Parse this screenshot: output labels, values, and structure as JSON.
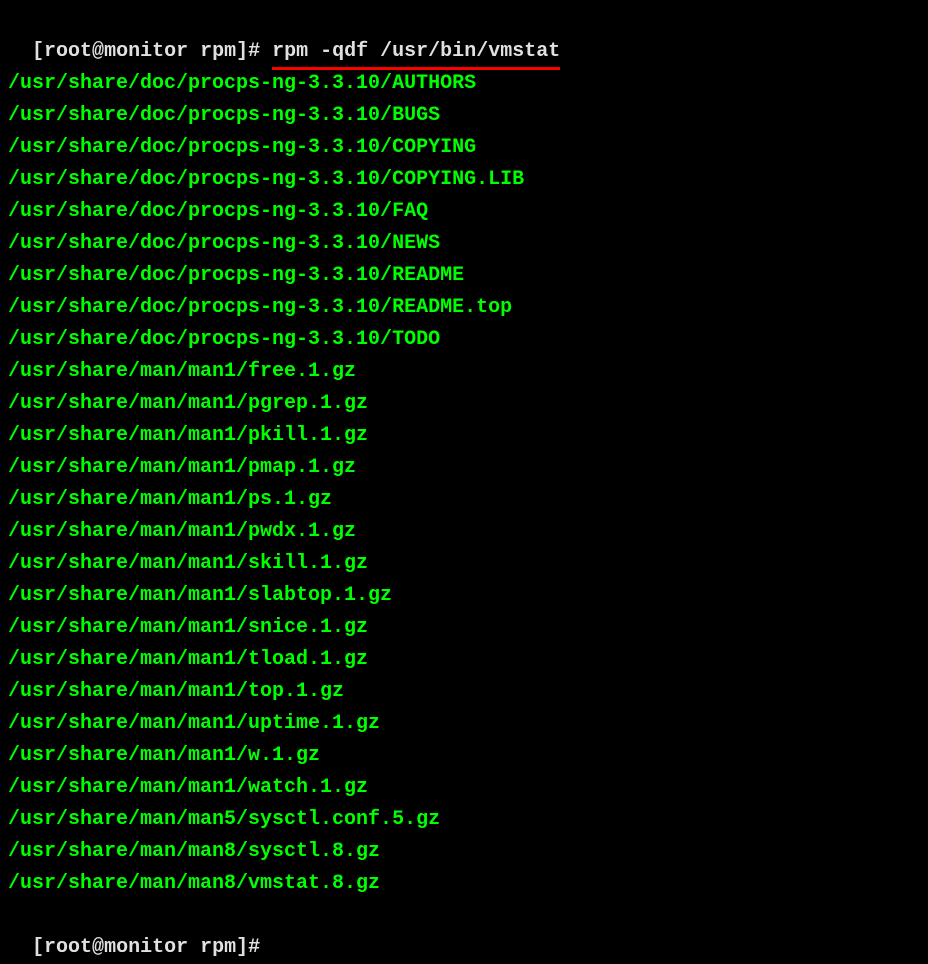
{
  "prompt1": {
    "user": "root",
    "host": "monitor",
    "dir": "rpm",
    "symbol": "#"
  },
  "command": "rpm -qdf /usr/bin/vmstat",
  "output": [
    "/usr/share/doc/procps-ng-3.3.10/AUTHORS",
    "/usr/share/doc/procps-ng-3.3.10/BUGS",
    "/usr/share/doc/procps-ng-3.3.10/COPYING",
    "/usr/share/doc/procps-ng-3.3.10/COPYING.LIB",
    "/usr/share/doc/procps-ng-3.3.10/FAQ",
    "/usr/share/doc/procps-ng-3.3.10/NEWS",
    "/usr/share/doc/procps-ng-3.3.10/README",
    "/usr/share/doc/procps-ng-3.3.10/README.top",
    "/usr/share/doc/procps-ng-3.3.10/TODO",
    "/usr/share/man/man1/free.1.gz",
    "/usr/share/man/man1/pgrep.1.gz",
    "/usr/share/man/man1/pkill.1.gz",
    "/usr/share/man/man1/pmap.1.gz",
    "/usr/share/man/man1/ps.1.gz",
    "/usr/share/man/man1/pwdx.1.gz",
    "/usr/share/man/man1/skill.1.gz",
    "/usr/share/man/man1/slabtop.1.gz",
    "/usr/share/man/man1/snice.1.gz",
    "/usr/share/man/man1/tload.1.gz",
    "/usr/share/man/man1/top.1.gz",
    "/usr/share/man/man1/uptime.1.gz",
    "/usr/share/man/man1/w.1.gz",
    "/usr/share/man/man1/watch.1.gz",
    "/usr/share/man/man5/sysctl.conf.5.gz",
    "/usr/share/man/man8/sysctl.8.gz",
    "/usr/share/man/man8/vmstat.8.gz"
  ],
  "prompt2": {
    "user": "root",
    "host": "monitor",
    "dir": "rpm",
    "symbol": "#"
  }
}
